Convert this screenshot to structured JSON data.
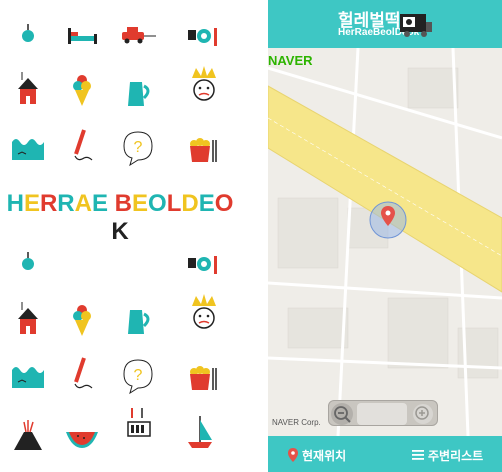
{
  "splash": {
    "brand_title": "HERRAE BEOLDEOK",
    "brand_letters": [
      "H",
      "E",
      "R",
      "R",
      "A",
      "E",
      " ",
      "B",
      "E",
      "O",
      "L",
      "D",
      "E",
      "O",
      "K"
    ],
    "letter_colors": [
      "#1fb5b2",
      "#f0c420",
      "#e03b2e",
      "#1fb5b2",
      "#f0c420",
      "#1fb5b2",
      " ",
      "#e03b2e",
      "#f0c420",
      "#1fb5b2",
      "#e03b2e",
      "#f0c420",
      "#1fb5b2",
      "#e03b2e",
      "#222222"
    ],
    "icons": [
      "apple-icon",
      "bed-icon",
      "car-icon",
      "cup-icon",
      "house-icon",
      "ice-cream-icon",
      "jug-icon",
      "king-icon",
      "water-icon",
      "pencil-icon",
      "question-bubble-icon",
      "popcorn-icon",
      "volcano-icon",
      "watermelon-icon",
      "battery-icon",
      "sailboat-icon"
    ]
  },
  "app": {
    "title": "헐레벌떡",
    "subtitle": "HerRaeBeolDeok"
  },
  "map": {
    "provider_logo": "NAVER",
    "copyright": "NAVER Corp."
  },
  "bottom_bar": {
    "location_label": "현재위치",
    "list_label": "주변리스트"
  },
  "colors": {
    "accent": "#3ec7c4",
    "road": "#f6e68a",
    "pin": "#e5524a"
  }
}
